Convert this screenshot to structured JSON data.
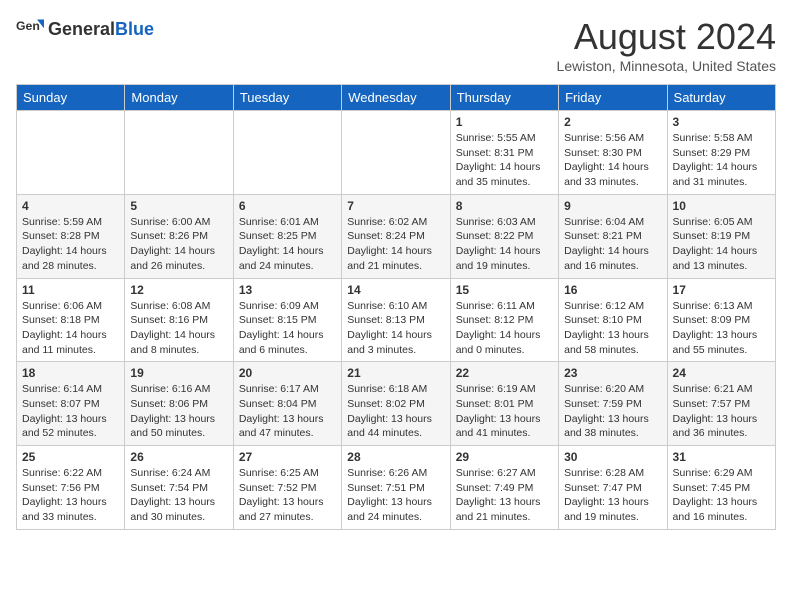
{
  "logo": {
    "text_general": "General",
    "text_blue": "Blue"
  },
  "title": "August 2024",
  "subtitle": "Lewiston, Minnesota, United States",
  "days_of_week": [
    "Sunday",
    "Monday",
    "Tuesday",
    "Wednesday",
    "Thursday",
    "Friday",
    "Saturday"
  ],
  "weeks": [
    [
      {
        "day": "",
        "info": ""
      },
      {
        "day": "",
        "info": ""
      },
      {
        "day": "",
        "info": ""
      },
      {
        "day": "",
        "info": ""
      },
      {
        "day": "1",
        "info": "Sunrise: 5:55 AM\nSunset: 8:31 PM\nDaylight: 14 hours and 35 minutes."
      },
      {
        "day": "2",
        "info": "Sunrise: 5:56 AM\nSunset: 8:30 PM\nDaylight: 14 hours and 33 minutes."
      },
      {
        "day": "3",
        "info": "Sunrise: 5:58 AM\nSunset: 8:29 PM\nDaylight: 14 hours and 31 minutes."
      }
    ],
    [
      {
        "day": "4",
        "info": "Sunrise: 5:59 AM\nSunset: 8:28 PM\nDaylight: 14 hours and 28 minutes."
      },
      {
        "day": "5",
        "info": "Sunrise: 6:00 AM\nSunset: 8:26 PM\nDaylight: 14 hours and 26 minutes."
      },
      {
        "day": "6",
        "info": "Sunrise: 6:01 AM\nSunset: 8:25 PM\nDaylight: 14 hours and 24 minutes."
      },
      {
        "day": "7",
        "info": "Sunrise: 6:02 AM\nSunset: 8:24 PM\nDaylight: 14 hours and 21 minutes."
      },
      {
        "day": "8",
        "info": "Sunrise: 6:03 AM\nSunset: 8:22 PM\nDaylight: 14 hours and 19 minutes."
      },
      {
        "day": "9",
        "info": "Sunrise: 6:04 AM\nSunset: 8:21 PM\nDaylight: 14 hours and 16 minutes."
      },
      {
        "day": "10",
        "info": "Sunrise: 6:05 AM\nSunset: 8:19 PM\nDaylight: 14 hours and 13 minutes."
      }
    ],
    [
      {
        "day": "11",
        "info": "Sunrise: 6:06 AM\nSunset: 8:18 PM\nDaylight: 14 hours and 11 minutes."
      },
      {
        "day": "12",
        "info": "Sunrise: 6:08 AM\nSunset: 8:16 PM\nDaylight: 14 hours and 8 minutes."
      },
      {
        "day": "13",
        "info": "Sunrise: 6:09 AM\nSunset: 8:15 PM\nDaylight: 14 hours and 6 minutes."
      },
      {
        "day": "14",
        "info": "Sunrise: 6:10 AM\nSunset: 8:13 PM\nDaylight: 14 hours and 3 minutes."
      },
      {
        "day": "15",
        "info": "Sunrise: 6:11 AM\nSunset: 8:12 PM\nDaylight: 14 hours and 0 minutes."
      },
      {
        "day": "16",
        "info": "Sunrise: 6:12 AM\nSunset: 8:10 PM\nDaylight: 13 hours and 58 minutes."
      },
      {
        "day": "17",
        "info": "Sunrise: 6:13 AM\nSunset: 8:09 PM\nDaylight: 13 hours and 55 minutes."
      }
    ],
    [
      {
        "day": "18",
        "info": "Sunrise: 6:14 AM\nSunset: 8:07 PM\nDaylight: 13 hours and 52 minutes."
      },
      {
        "day": "19",
        "info": "Sunrise: 6:16 AM\nSunset: 8:06 PM\nDaylight: 13 hours and 50 minutes."
      },
      {
        "day": "20",
        "info": "Sunrise: 6:17 AM\nSunset: 8:04 PM\nDaylight: 13 hours and 47 minutes."
      },
      {
        "day": "21",
        "info": "Sunrise: 6:18 AM\nSunset: 8:02 PM\nDaylight: 13 hours and 44 minutes."
      },
      {
        "day": "22",
        "info": "Sunrise: 6:19 AM\nSunset: 8:01 PM\nDaylight: 13 hours and 41 minutes."
      },
      {
        "day": "23",
        "info": "Sunrise: 6:20 AM\nSunset: 7:59 PM\nDaylight: 13 hours and 38 minutes."
      },
      {
        "day": "24",
        "info": "Sunrise: 6:21 AM\nSunset: 7:57 PM\nDaylight: 13 hours and 36 minutes."
      }
    ],
    [
      {
        "day": "25",
        "info": "Sunrise: 6:22 AM\nSunset: 7:56 PM\nDaylight: 13 hours and 33 minutes."
      },
      {
        "day": "26",
        "info": "Sunrise: 6:24 AM\nSunset: 7:54 PM\nDaylight: 13 hours and 30 minutes."
      },
      {
        "day": "27",
        "info": "Sunrise: 6:25 AM\nSunset: 7:52 PM\nDaylight: 13 hours and 27 minutes."
      },
      {
        "day": "28",
        "info": "Sunrise: 6:26 AM\nSunset: 7:51 PM\nDaylight: 13 hours and 24 minutes."
      },
      {
        "day": "29",
        "info": "Sunrise: 6:27 AM\nSunset: 7:49 PM\nDaylight: 13 hours and 21 minutes."
      },
      {
        "day": "30",
        "info": "Sunrise: 6:28 AM\nSunset: 7:47 PM\nDaylight: 13 hours and 19 minutes."
      },
      {
        "day": "31",
        "info": "Sunrise: 6:29 AM\nSunset: 7:45 PM\nDaylight: 13 hours and 16 minutes."
      }
    ]
  ]
}
